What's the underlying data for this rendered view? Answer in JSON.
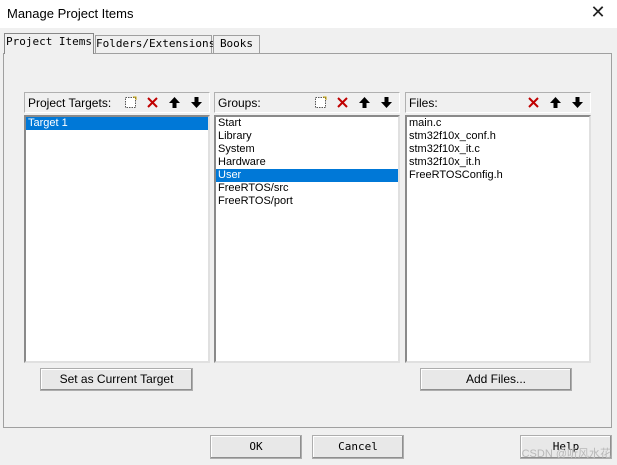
{
  "window": {
    "title": "Manage Project Items",
    "close_glyph": "✕"
  },
  "tabs": [
    {
      "label": "Project Items",
      "active": true
    },
    {
      "label": "Folders/Extensions",
      "active": false
    },
    {
      "label": "Books",
      "active": false
    }
  ],
  "panes": {
    "targets": {
      "label": "Project Targets:",
      "icons": [
        "new-icon",
        "delete-icon",
        "move-up-icon",
        "move-down-icon"
      ],
      "items": [
        {
          "text": "Target 1",
          "selected": true
        }
      ]
    },
    "groups": {
      "label": "Groups:",
      "icons": [
        "new-icon",
        "delete-icon",
        "move-up-icon",
        "move-down-icon"
      ],
      "items": [
        {
          "text": "Start",
          "selected": false
        },
        {
          "text": "Library",
          "selected": false
        },
        {
          "text": "System",
          "selected": false
        },
        {
          "text": "Hardware",
          "selected": false
        },
        {
          "text": "User",
          "selected": true
        },
        {
          "text": "FreeRTOS/src",
          "selected": false
        },
        {
          "text": "FreeRTOS/port",
          "selected": false
        }
      ]
    },
    "files": {
      "label": "Files:",
      "icons": [
        "delete-icon",
        "move-up-icon",
        "move-down-icon"
      ],
      "items": [
        {
          "text": "main.c",
          "selected": false
        },
        {
          "text": "stm32f10x_conf.h",
          "selected": false
        },
        {
          "text": "stm32f10x_it.c",
          "selected": false
        },
        {
          "text": "stm32f10x_it.h",
          "selected": false
        },
        {
          "text": "FreeRTOSConfig.h",
          "selected": false
        }
      ]
    }
  },
  "buttons": {
    "set_current_target": "Set as Current Target",
    "add_files": "Add Files...",
    "ok": "OK",
    "cancel": "Cancel",
    "help": "Help"
  },
  "watermark": "CSDN @听风水花",
  "colors": {
    "selection": "#0078d7",
    "delete_red": "#c00000"
  }
}
